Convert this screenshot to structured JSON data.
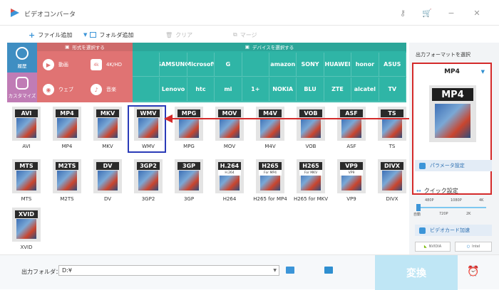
{
  "window": {
    "title": "ビデオコンバータ"
  },
  "toolbar": {
    "add_file": "ファイル追加",
    "add_folder": "フォルダ追加",
    "clear": "クリア",
    "merge": "マージ"
  },
  "format_bar": {
    "history_label": "履歴",
    "customize_label": "カスタマイズ",
    "format_header": "形式を選択する",
    "format_items": [
      "動画",
      "4K/HD",
      "ウェブ",
      "音楽"
    ],
    "device_header": "デバイスを選択する",
    "devices_row1": [
      "",
      "SAMSUNG",
      "Microsoft",
      "G",
      "",
      "amazon",
      "SONY",
      "HUAWEI",
      "honor",
      "ASUS"
    ],
    "devices_row2": [
      "",
      "Lenovo",
      "htc",
      "mi",
      "1+",
      "NOKIA",
      "BLU",
      "ZTE",
      "alcatel",
      "TV"
    ]
  },
  "formats_row1": [
    {
      "name": "AVI",
      "label": "AVI"
    },
    {
      "name": "MP4",
      "label": "MP4"
    },
    {
      "name": "MKV",
      "label": "MKV"
    },
    {
      "name": "WMV",
      "label": "WMV"
    },
    {
      "name": "MPG",
      "label": "MPG"
    },
    {
      "name": "MOV",
      "label": "MOV"
    },
    {
      "name": "M4V",
      "label": "M4V"
    },
    {
      "name": "VOB",
      "label": "VOB"
    },
    {
      "name": "ASF",
      "label": "ASF"
    },
    {
      "name": "TS",
      "label": "TS"
    }
  ],
  "formats_row2": [
    {
      "name": "MTS",
      "label": "MTS"
    },
    {
      "name": "M2TS",
      "label": "M2TS"
    },
    {
      "name": "DV",
      "label": "DV"
    },
    {
      "name": "3GP2",
      "label": "3GP2"
    },
    {
      "name": "3GP",
      "label": "3GP"
    },
    {
      "name": "H.264",
      "sub": "H.264",
      "label": "H264"
    },
    {
      "name": "H265",
      "sub": "For MP4",
      "label": "H265 for MP4"
    },
    {
      "name": "H265",
      "sub": "For MKV",
      "label": "H265 for MKV"
    },
    {
      "name": "VP9",
      "sub": "VP9",
      "label": "VP9"
    },
    {
      "name": "DIVX",
      "sub": "",
      "label": "DIVX"
    }
  ],
  "formats_row3": [
    {
      "name": "XVID",
      "label": "XVID"
    }
  ],
  "right_panel": {
    "title": "出力フォーマットを選択",
    "selected_format": "MP4",
    "thumb_label": "MP4",
    "params_button": "パラメータ設定",
    "quick_settings": "クイック設定",
    "ticks_top": [
      "480P",
      "1080P",
      "4K"
    ],
    "ticks_bottom": [
      "自動",
      "720P",
      "2K"
    ],
    "gpu_button": "ビデオカード加速",
    "gpu_nvidia": "NVIDIA",
    "gpu_intel": "Intel"
  },
  "bottom": {
    "output_label": "出力フォルダ：",
    "output_path": "D:¥",
    "convert_button": "変換"
  },
  "colors": {
    "accent": "#3c95d8",
    "format_red": "#e07373",
    "device_teal": "#2fb5a6",
    "highlight_red": "#d42a2a",
    "select_blue": "#2a3bb8"
  }
}
